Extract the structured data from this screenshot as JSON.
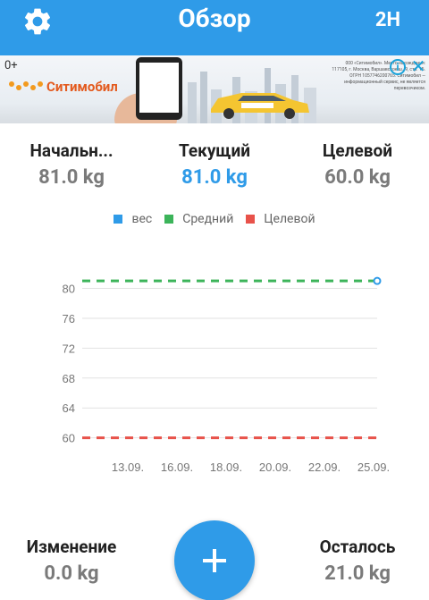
{
  "header": {
    "title": "Обзор",
    "range_label": "2Н"
  },
  "ad": {
    "age_rating": "0+",
    "brand_name": "Ситимобил",
    "legal_text": "000 «Ситимобил». Место нахождения: 117105, г. Москва, Варшавское ш., 9, стр. 1Б. ОГРН 1057746200765. Ситимобил — информационный сервис, не является перевозчиком."
  },
  "stats": {
    "start": {
      "label": "Начальн...",
      "value": "81.0 kg"
    },
    "current": {
      "label": "Текущий",
      "value": "81.0 kg"
    },
    "target": {
      "label": "Целевой",
      "value": "60.0 kg"
    }
  },
  "legend": [
    {
      "label": "вес",
      "color": "#2f9be8"
    },
    {
      "label": "Средний",
      "color": "#3cb45a"
    },
    {
      "label": "Целевой",
      "color": "#e8524a"
    }
  ],
  "chart_data": {
    "type": "line",
    "x": [
      "13.09.",
      "16.09.",
      "18.09.",
      "20.09.",
      "22.09.",
      "25.09."
    ],
    "ylim": [
      59,
      81.5
    ],
    "yticks": [
      60,
      64,
      68,
      72,
      76,
      80
    ],
    "grid": true,
    "series": [
      {
        "name": "вес",
        "color": "#2f9be8",
        "points": [
          {
            "x": "25.09.",
            "y": 81.0
          }
        ]
      },
      {
        "name": "Средний",
        "color": "#3cb45a",
        "style": "dashed",
        "y": 81.0
      },
      {
        "name": "Целевой",
        "color": "#e8524a",
        "style": "dashed",
        "y": 60.0
      }
    ]
  },
  "summary": {
    "change": {
      "label": "Изменение",
      "value": "0.0 kg"
    },
    "remaining": {
      "label": "Осталось",
      "value": "21.0 kg"
    }
  },
  "fab": {
    "icon": "plus-icon"
  }
}
